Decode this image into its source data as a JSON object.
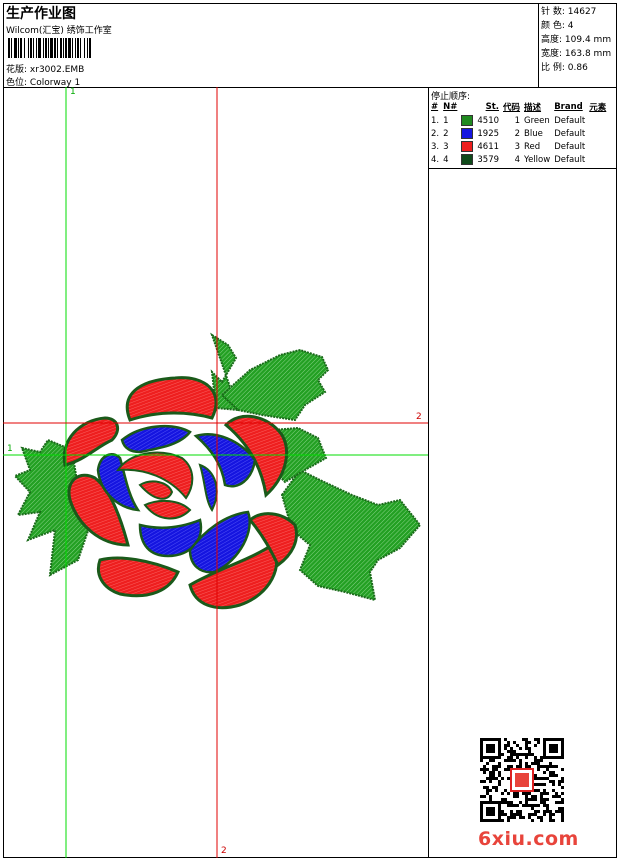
{
  "header": {
    "title": "生产作业图",
    "subtitle": "Wilcom(汇宝) 绣饰工作室",
    "design_label": "花版:",
    "design_value": "xr3002.EMB",
    "colorway_label": "色位:",
    "colorway_value": "Colorway 1"
  },
  "specs": {
    "stitches_label": "针 数:",
    "stitches_value": "14627",
    "colors_label": "颜 色:",
    "colors_value": "4",
    "height_label": "高度:",
    "height_value": "109.4 mm",
    "width_label": "宽度:",
    "width_value": "163.8 mm",
    "scale_label": "比 例:",
    "scale_value": "0.86"
  },
  "stop_sequence": {
    "title": "停止顺序:",
    "headers": [
      "#",
      "N#",
      "St.",
      "代码",
      "描述",
      "Brand",
      "元素"
    ],
    "rows": [
      {
        "num": "1.",
        "n": "1",
        "code": "4510",
        "st": "1",
        "desc": "Green",
        "brand": "Default",
        "color": "#1f8a1f"
      },
      {
        "num": "2.",
        "n": "2",
        "code": "1925",
        "st": "2",
        "desc": "Blue",
        "brand": "Default",
        "color": "#1515e0"
      },
      {
        "num": "3.",
        "n": "3",
        "code": "4611",
        "st": "3",
        "desc": "Red",
        "brand": "Default",
        "color": "#ee1f1f"
      },
      {
        "num": "4.",
        "n": "4",
        "code": "3579",
        "st": "4",
        "desc": "Yellow",
        "brand": "Default",
        "color": "#0f4a1a"
      }
    ]
  },
  "guides": {
    "v1_label": "1",
    "h1_label": "1",
    "h2_label": "2",
    "v2_label": "2",
    "green_color": "#00dd00",
    "red_color": "#e00000"
  },
  "watermark": {
    "text": "6xiu.com",
    "color": "#e8443b"
  }
}
